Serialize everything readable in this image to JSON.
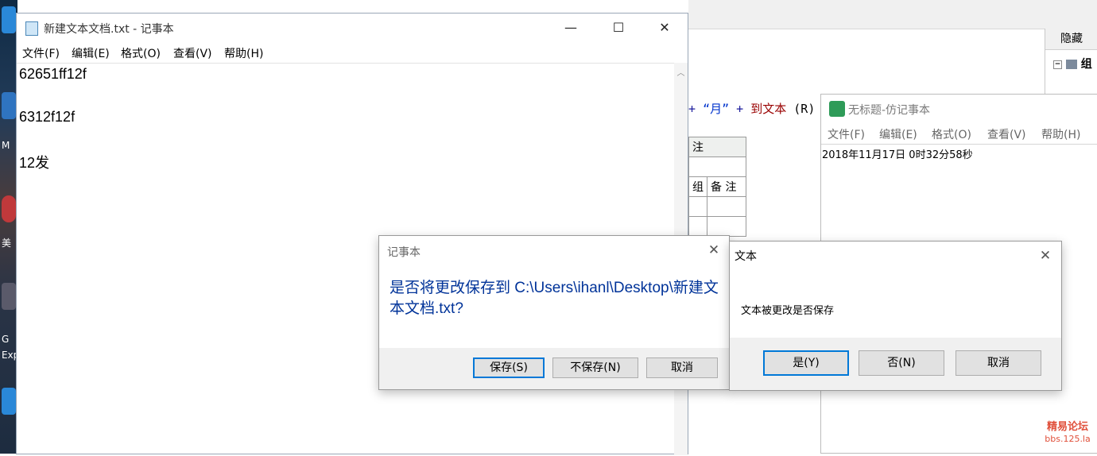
{
  "notepad": {
    "title": "新建文本文档.txt - 记事本",
    "menu": [
      "文件(F)",
      "编辑(E)",
      "格式(O)",
      "查看(V)",
      "帮助(H)"
    ],
    "lines": [
      "62651ff12f",
      "6312f12f",
      "12发"
    ],
    "controls": {
      "minimize": "—",
      "maximize": "☐",
      "close": "✕"
    }
  },
  "ide": {
    "code_op": "+",
    "code_str": "“月”",
    "code_op2": "+",
    "code_fn": "到文本",
    "code_arg": "(R)",
    "table_header": "注",
    "table_col1": "组",
    "table_col2": "备 注",
    "panel_title": "隐藏",
    "tree_label": "组"
  },
  "fake_notepad": {
    "title": "无标题-仿记事本",
    "menu": [
      "文件(F)",
      "编辑(E)",
      "格式(O)",
      "查看(V)",
      "帮助(H)"
    ],
    "content": "2018年11月17日  0时32分58秒"
  },
  "dialog_save": {
    "title": "记事本",
    "message": "是否将更改保存到 C:\\Users\\ihanl\\Desktop\\新建文本文档.txt?",
    "buttons": {
      "save": "保存(S)",
      "dont_save": "不保存(N)",
      "cancel": "取消"
    },
    "close": "✕"
  },
  "dialog_text": {
    "title": "文本",
    "message": "文本被更改是否保存",
    "buttons": {
      "yes": "是(Y)",
      "no": "否(N)",
      "cancel": "取消"
    },
    "close": "✕"
  },
  "desktop": {
    "labels": [
      "M",
      "美",
      "G",
      "Exp"
    ]
  },
  "watermark": {
    "line1": "精易论坛",
    "line2": "bbs.125.la"
  },
  "colors": {
    "accent": "#0078d7",
    "dialog_message": "#003399",
    "watermark": "#e0503b"
  }
}
